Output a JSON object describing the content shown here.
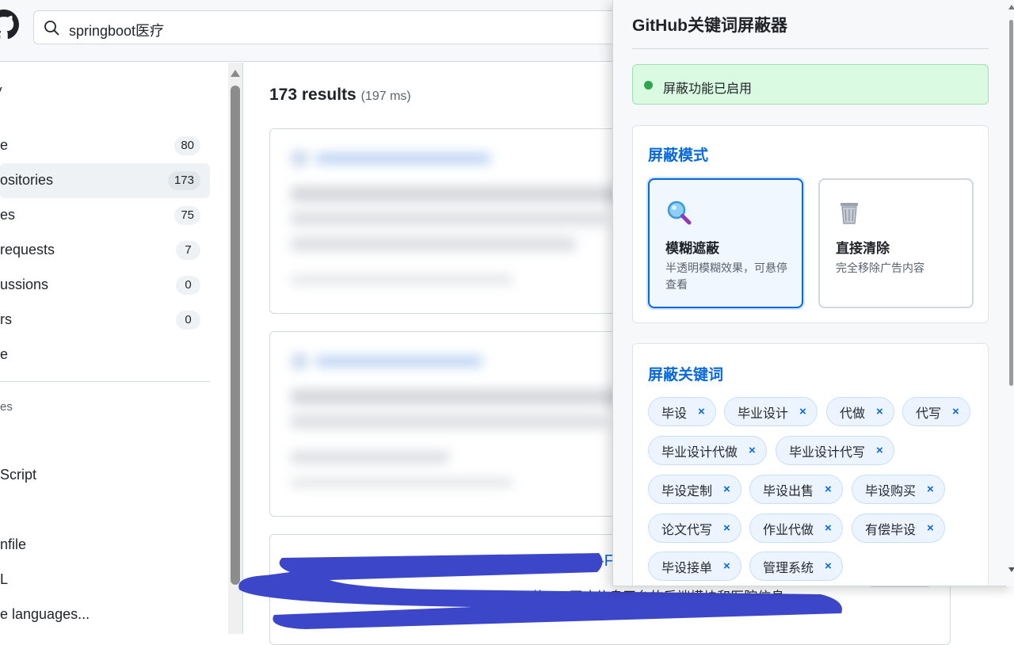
{
  "search": {
    "query": "springboot医疗"
  },
  "sidebar": {
    "title": "y",
    "items": [
      {
        "label": "e",
        "count": "80",
        "active": false
      },
      {
        "label": "ositories",
        "count": "173",
        "active": true
      },
      {
        "label": "es",
        "count": "75",
        "active": false
      },
      {
        "label": "requests",
        "count": "7",
        "active": false
      },
      {
        "label": "ussions",
        "count": "0",
        "active": false
      },
      {
        "label": "rs",
        "count": "0",
        "active": false
      },
      {
        "label": "e",
        "count": "",
        "active": false
      }
    ],
    "languages_heading": "es",
    "languages": [
      "Script",
      "nfile",
      "L",
      "e languages..."
    ]
  },
  "results": {
    "count_label": "173 results",
    "time_label": "(197 ms)",
    "card3_title_fragment": "-F",
    "card3_desc_fragment": "的MIP医疗信息平台的后端模块和医院信息"
  },
  "extension": {
    "title": "GitHub关键词屏蔽器",
    "status": "屏蔽功能已启用",
    "mode_section_title": "屏蔽模式",
    "modes": [
      {
        "name": "模糊遮蔽",
        "desc": "半透明模糊效果，可悬停查看",
        "icon": "magnifier-icon",
        "selected": true
      },
      {
        "name": "直接清除",
        "desc": "完全移除广告内容",
        "icon": "trash-can-icon",
        "selected": false
      }
    ],
    "keywords_section_title": "屏蔽关键词",
    "keywords": [
      "毕设",
      "毕业设计",
      "代做",
      "代写",
      "毕业设计代做",
      "毕业设计代写",
      "毕设定制",
      "毕设出售",
      "毕设购买",
      "论文代写",
      "作业代做",
      "有偿毕设",
      "毕设接单",
      "管理系统"
    ],
    "remove_symbol": "×"
  },
  "colors": {
    "accent": "#0969da",
    "status_green": "#2da44e",
    "status_bg": "#dafbe1",
    "redaction": "#3c46c8"
  }
}
